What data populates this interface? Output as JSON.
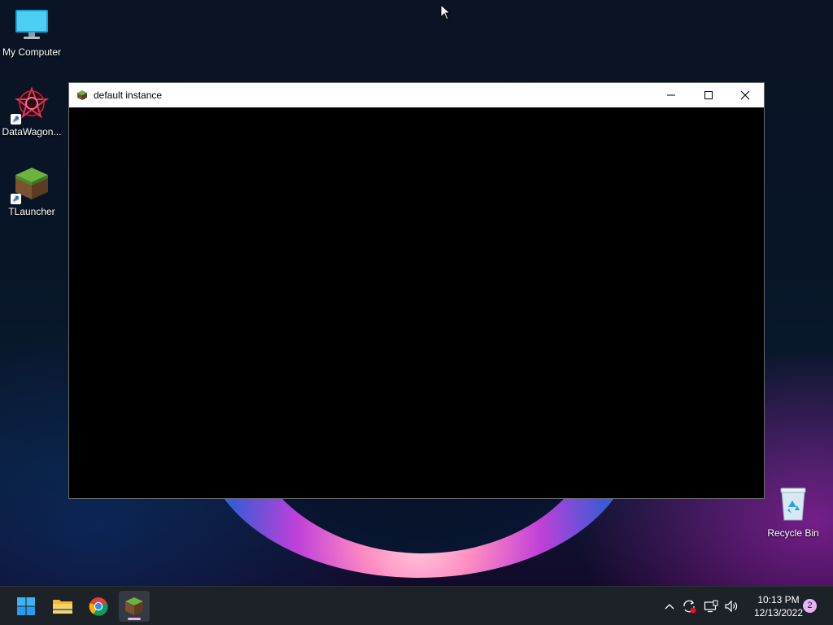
{
  "desktop": {
    "icons": [
      {
        "label": "My Computer",
        "icon": "monitor-icon"
      },
      {
        "label": "DataWagon...",
        "icon": "datawagon-icon"
      },
      {
        "label": "TLauncher",
        "icon": "grass-block-icon"
      },
      {
        "label": "Recycle Bin",
        "icon": "recycle-bin-icon"
      }
    ]
  },
  "window": {
    "title": "default instance",
    "icon": "grass-block-icon",
    "controls": [
      "minimize-icon",
      "maximize-icon",
      "close-icon"
    ]
  },
  "taskbar": {
    "apps": [
      {
        "name": "start",
        "icon": "windows-logo-icon"
      },
      {
        "name": "file-explorer",
        "icon": "folder-icon"
      },
      {
        "name": "chrome",
        "icon": "chrome-icon"
      },
      {
        "name": "minecraft",
        "icon": "grass-block-icon",
        "active": true
      }
    ],
    "tray_icons": [
      "chevron-up-icon",
      "sync-icon",
      "network-icon",
      "volume-icon"
    ],
    "clock": {
      "time": "10:13 PM",
      "date": "12/13/2022"
    },
    "notification_count": "2"
  },
  "colors": {
    "taskbar_bg": "#1d2128",
    "titlebar_bg": "#ffffff",
    "window_content_bg": "#000000",
    "accent_indicator": "#e7b4f4"
  }
}
